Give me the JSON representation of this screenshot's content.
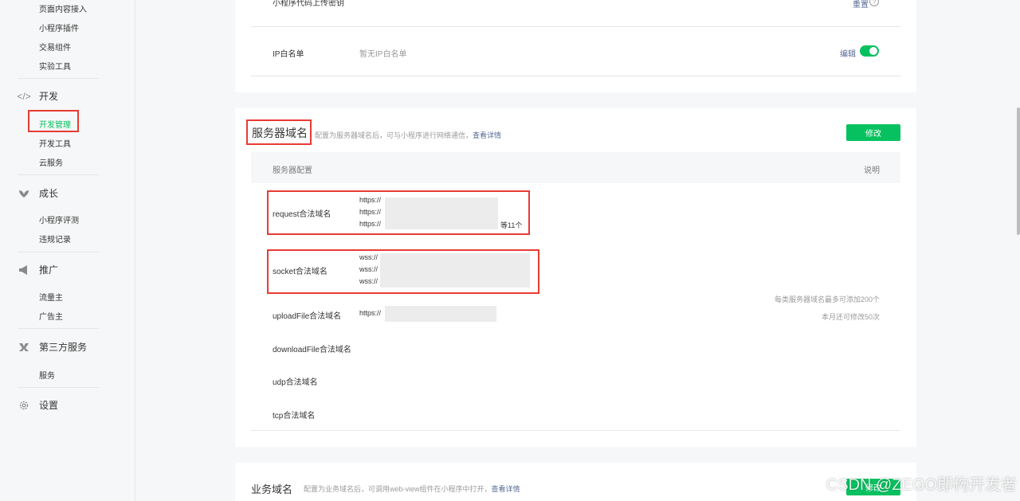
{
  "sidebar": {
    "top_items": [
      "页面内容接入",
      "小程序插件",
      "交易组件",
      "实验工具"
    ],
    "groups": {
      "dev": {
        "label": "开发",
        "icon": "code-icon",
        "items": [
          "开发管理",
          "开发工具",
          "云服务"
        ]
      },
      "growth": {
        "label": "成长",
        "icon": "leaf-icon",
        "items": [
          "小程序评测",
          "违规记录"
        ]
      },
      "promote": {
        "label": "推广",
        "icon": "megaphone-icon",
        "items": [
          "流量主",
          "广告主"
        ]
      },
      "third": {
        "label": "第三方服务",
        "icon": "third-party-icon",
        "items": [
          "服务"
        ]
      },
      "settings": {
        "label": "设置",
        "icon": "gear-icon"
      }
    },
    "active_item": "开发管理"
  },
  "top_panel": {
    "upload_key_label": "小程序代码上传密钥",
    "reset_label": "重置",
    "ip_label": "IP白名单",
    "ip_value": "暂无IP白名单",
    "edit_label": "编辑",
    "ip_toggle_on": true
  },
  "server_panel": {
    "title": "服务器域名",
    "desc": "配置为服务器域名后，可与小程序进行网络通信，",
    "detail_link": "查看详情",
    "modify_label": "修改",
    "col_config": "服务器配置",
    "col_desc": "说明",
    "request_label": "request合法域名",
    "request_urls": [
      "https://",
      "https://",
      "https://"
    ],
    "request_more": "等11个",
    "socket_label": "socket合法域名",
    "socket_urls": [
      "wss://",
      "wss://",
      "wss://"
    ],
    "upload_label": "uploadFile合法域名",
    "upload_url": "https://",
    "download_label": "downloadFile合法域名",
    "udp_label": "udp合法域名",
    "tcp_label": "tcp合法域名",
    "note_limit": "每类服务器域名最多可添加200个",
    "note_month": "本月还可修改50次"
  },
  "business_panel": {
    "title": "业务域名",
    "desc": "配置为业务域名后，可调用web-view组件在小程序中打开，",
    "detail_link": "查看详情",
    "modify_label": "修改"
  },
  "watermark": "CSDN @ZEGO即构开发者",
  "colors": {
    "accent": "#07c160",
    "link": "#576b95",
    "highlight": "#e83b33"
  }
}
